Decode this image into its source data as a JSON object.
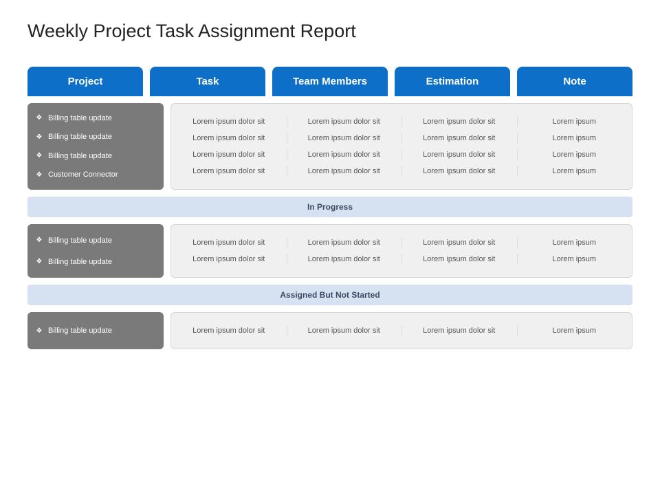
{
  "title": "Weekly Project Task Assignment Report",
  "headers": [
    "Project",
    "Task",
    "Team Members",
    "Estimation",
    "Note"
  ],
  "sections": [
    {
      "status": null,
      "projects": [
        "Billing  table update",
        "Billing  table update",
        "Billing  table update",
        "Customer  Connector"
      ],
      "rows": [
        [
          "Lorem ipsum dolor sit",
          "Lorem ipsum dolor sit",
          "Lorem ipsum dolor sit",
          "Lorem ipsum"
        ],
        [
          "Lorem ipsum dolor sit",
          "Lorem ipsum dolor sit",
          "Lorem ipsum dolor sit",
          "Lorem ipsum"
        ],
        [
          "Lorem ipsum dolor sit",
          "Lorem ipsum dolor sit",
          "Lorem ipsum dolor sit",
          "Lorem ipsum"
        ],
        [
          "Lorem ipsum dolor sit",
          "Lorem ipsum dolor sit",
          "Lorem ipsum dolor sit",
          "Lorem ipsum"
        ]
      ]
    },
    {
      "status": "In Progress",
      "projects": [
        "Billing  table update",
        "Billing  table update"
      ],
      "rows": [
        [
          "Lorem ipsum dolor sit",
          "Lorem ipsum dolor sit",
          "Lorem ipsum dolor sit",
          "Lorem ipsum"
        ],
        [
          "Lorem ipsum dolor sit",
          "Lorem ipsum dolor sit",
          "Lorem ipsum dolor sit",
          "Lorem ipsum"
        ]
      ]
    },
    {
      "status": "Assigned But Not Started",
      "projects": [
        "Billing  table update"
      ],
      "rows": [
        [
          "Lorem ipsum dolor sit",
          "Lorem ipsum dolor sit",
          "Lorem ipsum dolor sit",
          "Lorem ipsum"
        ]
      ]
    }
  ]
}
